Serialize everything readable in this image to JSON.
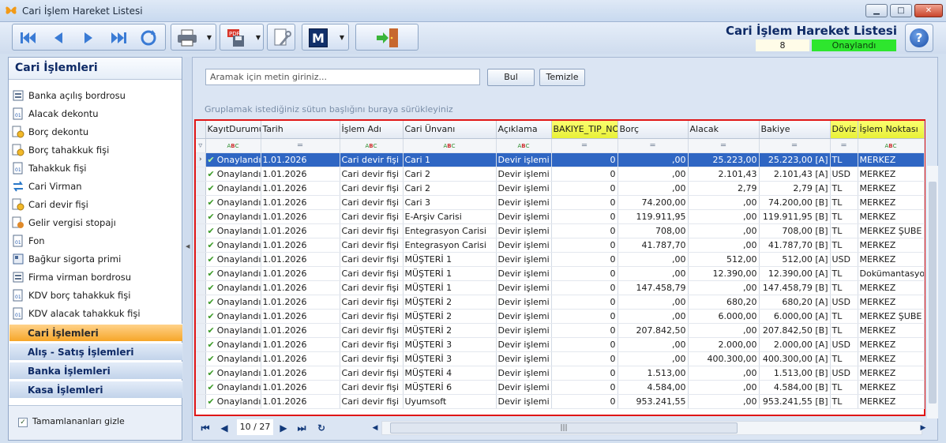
{
  "window": {
    "title": "Cari İşlem Hareket Listesi"
  },
  "header": {
    "title": "Cari İşlem Hareket Listesi",
    "count": "8",
    "status": "Onaylandı",
    "status_color": "#2ee62e"
  },
  "toolbar": {
    "m_label": "M"
  },
  "sidebar": {
    "title": "Cari İşlemleri",
    "items": [
      {
        "label": "Banka açılış bordrosu",
        "icon": "bank-doc-icon"
      },
      {
        "label": "Alacak dekontu",
        "icon": "receipt-icon"
      },
      {
        "label": "Borç dekontu",
        "icon": "coins-icon"
      },
      {
        "label": "Borç tahakkuk fişi",
        "icon": "coins-icon"
      },
      {
        "label": "Tahakkuk fişi",
        "icon": "receipt-icon"
      },
      {
        "label": "Cari Virman",
        "icon": "transfer-icon"
      },
      {
        "label": "Cari devir fişi",
        "icon": "coins-icon"
      },
      {
        "label": "Gelir vergisi stopajı",
        "icon": "tax-icon"
      },
      {
        "label": "Fon",
        "icon": "receipt-icon"
      },
      {
        "label": "Bağkur sigorta primi",
        "icon": "doc-icon"
      },
      {
        "label": "Firma virman bordrosu",
        "icon": "bank-doc-icon"
      },
      {
        "label": "KDV borç tahakkuk fişi",
        "icon": "receipt-icon"
      },
      {
        "label": "KDV alacak tahakkuk fişi",
        "icon": "receipt-icon"
      }
    ],
    "groups": [
      "Cari İşlemleri",
      "Alış - Satış İşlemleri",
      "Banka İşlemleri",
      "Kasa İşlemleri"
    ],
    "hide_completed": "Tamamlananları gizle"
  },
  "search": {
    "placeholder": "Aramak için metin giriniz...",
    "find": "Bul",
    "clear": "Temizle"
  },
  "grid": {
    "group_hint": "Gruplamak istediğiniz sütun başlığını buraya sürükleyiniz",
    "columns": [
      "KayıtDurumu",
      "Tarih",
      "İşlem Adı",
      "Cari Ünvanı",
      "Açıklama",
      "BAKIYE_TIP_NO",
      "Borç",
      "Alacak",
      "Bakiye",
      "Döviz",
      "İşlem Noktası"
    ],
    "rows": [
      [
        "Onaylandı",
        "1.01.2026",
        "Cari devir fişi",
        "Cari 1",
        "Devir işlemi",
        "0",
        ",00",
        "25.223,00",
        "25.223,00 [A]",
        "TL",
        "MERKEZ"
      ],
      [
        "Onaylandı",
        "1.01.2026",
        "Cari devir fişi",
        "Cari 2",
        "Devir işlemi",
        "0",
        ",00",
        "2.101,43",
        "2.101,43 [A]",
        "USD",
        "MERKEZ"
      ],
      [
        "Onaylandı",
        "1.01.2026",
        "Cari devir fişi",
        "Cari 2",
        "Devir işlemi",
        "0",
        ",00",
        "2,79",
        "2,79 [A]",
        "TL",
        "MERKEZ"
      ],
      [
        "Onaylandı",
        "1.01.2026",
        "Cari devir fişi",
        "Cari 3",
        "Devir işlemi",
        "0",
        "74.200,00",
        ",00",
        "74.200,00 [B]",
        "TL",
        "MERKEZ"
      ],
      [
        "Onaylandı",
        "1.01.2026",
        "Cari devir fişi",
        "E-Arşiv Carisi",
        "Devir işlemi",
        "0",
        "119.911,95",
        ",00",
        "119.911,95 [B]",
        "TL",
        "MERKEZ"
      ],
      [
        "Onaylandı",
        "1.01.2026",
        "Cari devir fişi",
        "Entegrasyon Carisi",
        "Devir işlemi",
        "0",
        "708,00",
        ",00",
        "708,00 [B]",
        "TL",
        "MERKEZ ŞUBE"
      ],
      [
        "Onaylandı",
        "1.01.2026",
        "Cari devir fişi",
        "Entegrasyon Carisi",
        "Devir işlemi",
        "0",
        "41.787,70",
        ",00",
        "41.787,70 [B]",
        "TL",
        "MERKEZ"
      ],
      [
        "Onaylandı",
        "1.01.2026",
        "Cari devir fişi",
        "MÜŞTERİ 1",
        "Devir işlemi",
        "0",
        ",00",
        "512,00",
        "512,00 [A]",
        "USD",
        "MERKEZ"
      ],
      [
        "Onaylandı",
        "1.01.2026",
        "Cari devir fişi",
        "MÜŞTERİ 1",
        "Devir işlemi",
        "0",
        ",00",
        "12.390,00",
        "12.390,00 [A]",
        "TL",
        "Dokümantasyon"
      ],
      [
        "Onaylandı",
        "1.01.2026",
        "Cari devir fişi",
        "MÜŞTERİ 1",
        "Devir işlemi",
        "0",
        "147.458,79",
        ",00",
        "147.458,79 [B]",
        "TL",
        "MERKEZ"
      ],
      [
        "Onaylandı",
        "1.01.2026",
        "Cari devir fişi",
        "MÜŞTERİ 2",
        "Devir işlemi",
        "0",
        ",00",
        "680,20",
        "680,20 [A]",
        "USD",
        "MERKEZ"
      ],
      [
        "Onaylandı",
        "1.01.2026",
        "Cari devir fişi",
        "MÜŞTERİ 2",
        "Devir işlemi",
        "0",
        ",00",
        "6.000,00",
        "6.000,00 [A]",
        "TL",
        "MERKEZ ŞUBE"
      ],
      [
        "Onaylandı",
        "1.01.2026",
        "Cari devir fişi",
        "MÜŞTERİ 2",
        "Devir işlemi",
        "0",
        "207.842,50",
        ",00",
        "207.842,50 [B]",
        "TL",
        "MERKEZ"
      ],
      [
        "Onaylandı",
        "1.01.2026",
        "Cari devir fişi",
        "MÜŞTERİ 3",
        "Devir işlemi",
        "0",
        ",00",
        "2.000,00",
        "2.000,00 [A]",
        "USD",
        "MERKEZ"
      ],
      [
        "Onaylandı",
        "1.01.2026",
        "Cari devir fişi",
        "MÜŞTERİ 3",
        "Devir işlemi",
        "0",
        ",00",
        "400.300,00",
        "400.300,00 [A]",
        "TL",
        "MERKEZ"
      ],
      [
        "Onaylandı",
        "1.01.2026",
        "Cari devir fişi",
        "MÜŞTERİ 4",
        "Devir işlemi",
        "0",
        "1.513,00",
        ",00",
        "1.513,00 [B]",
        "USD",
        "MERKEZ"
      ],
      [
        "Onaylandı",
        "1.01.2026",
        "Cari devir fişi",
        "MÜŞTERİ 6",
        "Devir işlemi",
        "0",
        "4.584,00",
        ",00",
        "4.584,00 [B]",
        "TL",
        "MERKEZ"
      ],
      [
        "Onaylandı",
        "1.01.2026",
        "Cari devir fişi",
        "Uyumsoft",
        "Devir işlemi",
        "0",
        "953.241,55",
        ",00",
        "953.241,55 [B]",
        "TL",
        "MERKEZ"
      ]
    ]
  },
  "pager": {
    "page": "10 / 27"
  },
  "colors": {
    "accent": "#0e2a66",
    "selected_row": "#2f66c3",
    "highlight_header": "#e8f036",
    "frame": "#e01616"
  }
}
